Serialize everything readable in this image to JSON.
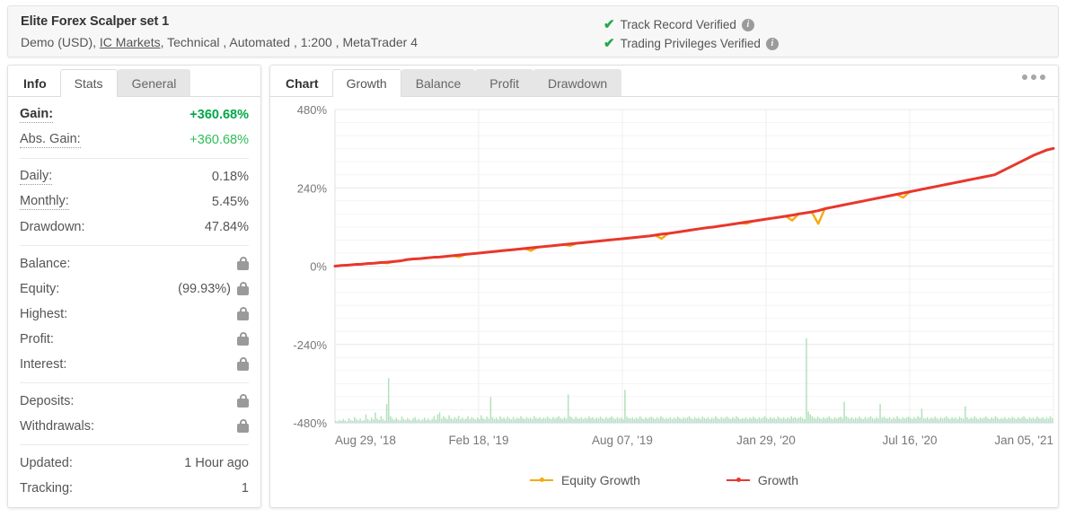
{
  "header": {
    "account_name": "Elite Forex Scalper set 1",
    "account_type": "Demo (USD),",
    "broker": "IC Markets",
    "details_tail": ", Technical , Automated , 1:200 , MetaTrader 4",
    "verifications": [
      {
        "label": "Track Record Verified",
        "icon": "check-icon",
        "info": "i"
      },
      {
        "label": "Trading Privileges Verified",
        "icon": "check-icon",
        "info": "i"
      }
    ]
  },
  "sidebar": {
    "panel_label": "Info",
    "tabs": [
      {
        "label": "Stats",
        "active": true
      },
      {
        "label": "General",
        "active": false
      }
    ],
    "groups": [
      {
        "rows": [
          {
            "label": "Gain:",
            "value": "+360.68%",
            "style": "gain-strong",
            "bold": true
          },
          {
            "label": "Abs. Gain:",
            "value": "+360.68%",
            "style": "gain-light",
            "bold": false
          }
        ]
      },
      {
        "rows": [
          {
            "label": "Daily:",
            "value": "0.18%"
          },
          {
            "label": "Monthly:",
            "value": "5.45%"
          },
          {
            "label": "Drawdown:",
            "value": "47.84%"
          }
        ]
      },
      {
        "rows": [
          {
            "label": "Balance:",
            "value": "",
            "locked": true
          },
          {
            "label": "Equity:",
            "value": "(99.93%)",
            "locked": true
          },
          {
            "label": "Highest:",
            "value": "",
            "locked": true
          },
          {
            "label": "Profit:",
            "value": "",
            "locked": true
          },
          {
            "label": "Interest:",
            "value": "",
            "locked": true
          }
        ]
      },
      {
        "rows": [
          {
            "label": "Deposits:",
            "value": "",
            "locked": true
          },
          {
            "label": "Withdrawals:",
            "value": "",
            "locked": true
          }
        ]
      },
      {
        "rows": [
          {
            "label": "Updated:",
            "value": "1 Hour ago"
          },
          {
            "label": "Tracking:",
            "value": "1"
          }
        ]
      }
    ]
  },
  "chart_panel": {
    "panel_label": "Chart",
    "tabs": [
      {
        "label": "Growth",
        "active": true
      },
      {
        "label": "Balance",
        "active": false
      },
      {
        "label": "Profit",
        "active": false
      },
      {
        "label": "Drawdown",
        "active": false
      }
    ],
    "menu_icon": "kebab-menu-icon"
  },
  "chart_data": {
    "type": "line",
    "title": "",
    "xlabel": "",
    "ylabel": "",
    "ylim": [
      -480,
      480
    ],
    "yticks": [
      480,
      240,
      0,
      -240,
      -480
    ],
    "ytick_labels": [
      "480%",
      "240%",
      "0%",
      "-240%",
      "-480%"
    ],
    "minor_tick_step": 40,
    "grid": true,
    "legend_position": "bottom",
    "xtick_labels": [
      "Aug 29, '18",
      "Feb 18, '19",
      "Aug 07, '19",
      "Jan 29, '20",
      "Jul 16, '20",
      "Jan 05, '21"
    ],
    "xtick_positions": [
      0,
      0.2,
      0.4,
      0.6,
      0.8,
      1.0
    ],
    "colors": {
      "growth": "#e8372c",
      "equity_growth": "#f5ab11",
      "drawdown_bars": "#a8dcb0"
    },
    "series": [
      {
        "name": "Equity Growth",
        "color": "#f5ab11",
        "note": "tracks Growth closely with sharp downward drawdown spikes",
        "values": [
          0,
          2,
          3,
          5,
          6,
          8,
          9,
          11,
          9,
          14,
          16,
          20,
          22,
          23,
          25,
          27,
          28,
          30,
          32,
          28,
          36,
          38,
          40,
          42,
          44,
          46,
          48,
          50,
          52,
          54,
          47,
          58,
          60,
          62,
          64,
          66,
          62,
          70,
          72,
          74,
          76,
          78,
          80,
          82,
          84,
          86,
          88,
          90,
          92,
          95,
          84,
          100,
          103,
          106,
          109,
          112,
          115,
          118,
          120,
          123,
          126,
          129,
          132,
          130,
          138,
          141,
          144,
          147,
          150,
          153,
          140,
          160,
          163,
          166,
          130,
          176,
          180,
          184,
          188,
          192,
          196,
          200,
          204,
          208,
          212,
          216,
          220,
          210,
          228,
          232,
          236,
          240,
          244,
          248,
          252,
          256,
          260,
          264,
          268,
          272,
          276,
          280,
          290,
          300,
          310,
          320,
          330,
          340,
          348,
          356,
          360.68
        ]
      },
      {
        "name": "Growth",
        "color": "#e8372c",
        "values": [
          0,
          2,
          3,
          5,
          6,
          8,
          9,
          11,
          12,
          14,
          16,
          20,
          22,
          23,
          25,
          27,
          28,
          30,
          32,
          34,
          36,
          38,
          40,
          42,
          44,
          46,
          48,
          50,
          52,
          54,
          56,
          58,
          60,
          62,
          64,
          66,
          68,
          70,
          72,
          74,
          76,
          78,
          80,
          82,
          84,
          86,
          88,
          90,
          92,
          95,
          98,
          100,
          103,
          106,
          109,
          112,
          115,
          118,
          120,
          123,
          126,
          129,
          132,
          135,
          138,
          141,
          144,
          147,
          150,
          153,
          156,
          160,
          163,
          166,
          170,
          176,
          180,
          184,
          188,
          192,
          196,
          200,
          204,
          208,
          212,
          216,
          220,
          224,
          228,
          232,
          236,
          240,
          244,
          248,
          252,
          256,
          260,
          264,
          268,
          272,
          276,
          280,
          290,
          300,
          310,
          320,
          330,
          340,
          348,
          356,
          360.68
        ]
      }
    ],
    "drawdown_bars": {
      "name": "Drawdown volume",
      "color": "#a8dcb0",
      "baseline": -480,
      "max_value": 200,
      "values": [
        4,
        3,
        6,
        4,
        8,
        5,
        3,
        10,
        6,
        4,
        12,
        7,
        5,
        9,
        4,
        6,
        18,
        8,
        5,
        11,
        7,
        22,
        9,
        6,
        14,
        8,
        5,
        40,
        95,
        14,
        9,
        6,
        11,
        7,
        5,
        13,
        8,
        6,
        10,
        7,
        5,
        9,
        12,
        6,
        8,
        5,
        7,
        11,
        6,
        9,
        5,
        8,
        14,
        7,
        18,
        22,
        9,
        14,
        11,
        8,
        16,
        10,
        7,
        12,
        9,
        15,
        8,
        11,
        7,
        9,
        14,
        8,
        12,
        9,
        7,
        11,
        8,
        16,
        10,
        7,
        13,
        9,
        55,
        12,
        8,
        11,
        7,
        14,
        9,
        11,
        8,
        13,
        9,
        7,
        12,
        8,
        11,
        9,
        14,
        10,
        8,
        12,
        9,
        11,
        8,
        14,
        10,
        9,
        12,
        8,
        11,
        9,
        13,
        10,
        8,
        12,
        9,
        11,
        14,
        10,
        8,
        12,
        9,
        60,
        14,
        11,
        8,
        13,
        10,
        9,
        12,
        8,
        11,
        9,
        14,
        10,
        12,
        8,
        11,
        9,
        13,
        10,
        8,
        12,
        9,
        11,
        14,
        10,
        8,
        12,
        9,
        11,
        8,
        70,
        13,
        10,
        9,
        12,
        8,
        11,
        9,
        14,
        10,
        8,
        12,
        9,
        11,
        13,
        10,
        8,
        12,
        9,
        14,
        11,
        8,
        10,
        9,
        12,
        8,
        11,
        9,
        13,
        10,
        8,
        12,
        9,
        11,
        14,
        10,
        8,
        12,
        9,
        11,
        8,
        13,
        10,
        9,
        12,
        8,
        11,
        9,
        14,
        10,
        8,
        12,
        9,
        11,
        13,
        10,
        8,
        12,
        9,
        14,
        11,
        8,
        10,
        9,
        12,
        8,
        11,
        9,
        13,
        10,
        8,
        12,
        9,
        11,
        14,
        10,
        8,
        12,
        9,
        11,
        8,
        13,
        10,
        9,
        12,
        8,
        11,
        9,
        14,
        10,
        12,
        9,
        11,
        13,
        10,
        8,
        180,
        24,
        18,
        14,
        11,
        9,
        13,
        10,
        8,
        12,
        9,
        11,
        14,
        10,
        8,
        12,
        9,
        11,
        13,
        10,
        45,
        14,
        11,
        9,
        12,
        8,
        11,
        9,
        13,
        10,
        8,
        12,
        9,
        11,
        14,
        10,
        8,
        12,
        9,
        40,
        11,
        13,
        10,
        9,
        12,
        8,
        11,
        9,
        14,
        10,
        8,
        12,
        9,
        11,
        13,
        10,
        8,
        12,
        9,
        14,
        11,
        30,
        10,
        9,
        12,
        8,
        11,
        9,
        13,
        10,
        8,
        12,
        9,
        11,
        14,
        10,
        8,
        12,
        9,
        11,
        8,
        13,
        10,
        9,
        35,
        12,
        8,
        11,
        9,
        14,
        10,
        8,
        12,
        9,
        11,
        13,
        10,
        8,
        12,
        9,
        14,
        11,
        8,
        10,
        9,
        12,
        8,
        11,
        9,
        13,
        10,
        8,
        12,
        9,
        11,
        14,
        10,
        8,
        12,
        9,
        11,
        8,
        13,
        10,
        9,
        12,
        8,
        11,
        9,
        14,
        10
      ]
    },
    "legend": [
      {
        "label": "Equity Growth",
        "color": "#f5ab11"
      },
      {
        "label": "Growth",
        "color": "#e8372c"
      }
    ]
  }
}
